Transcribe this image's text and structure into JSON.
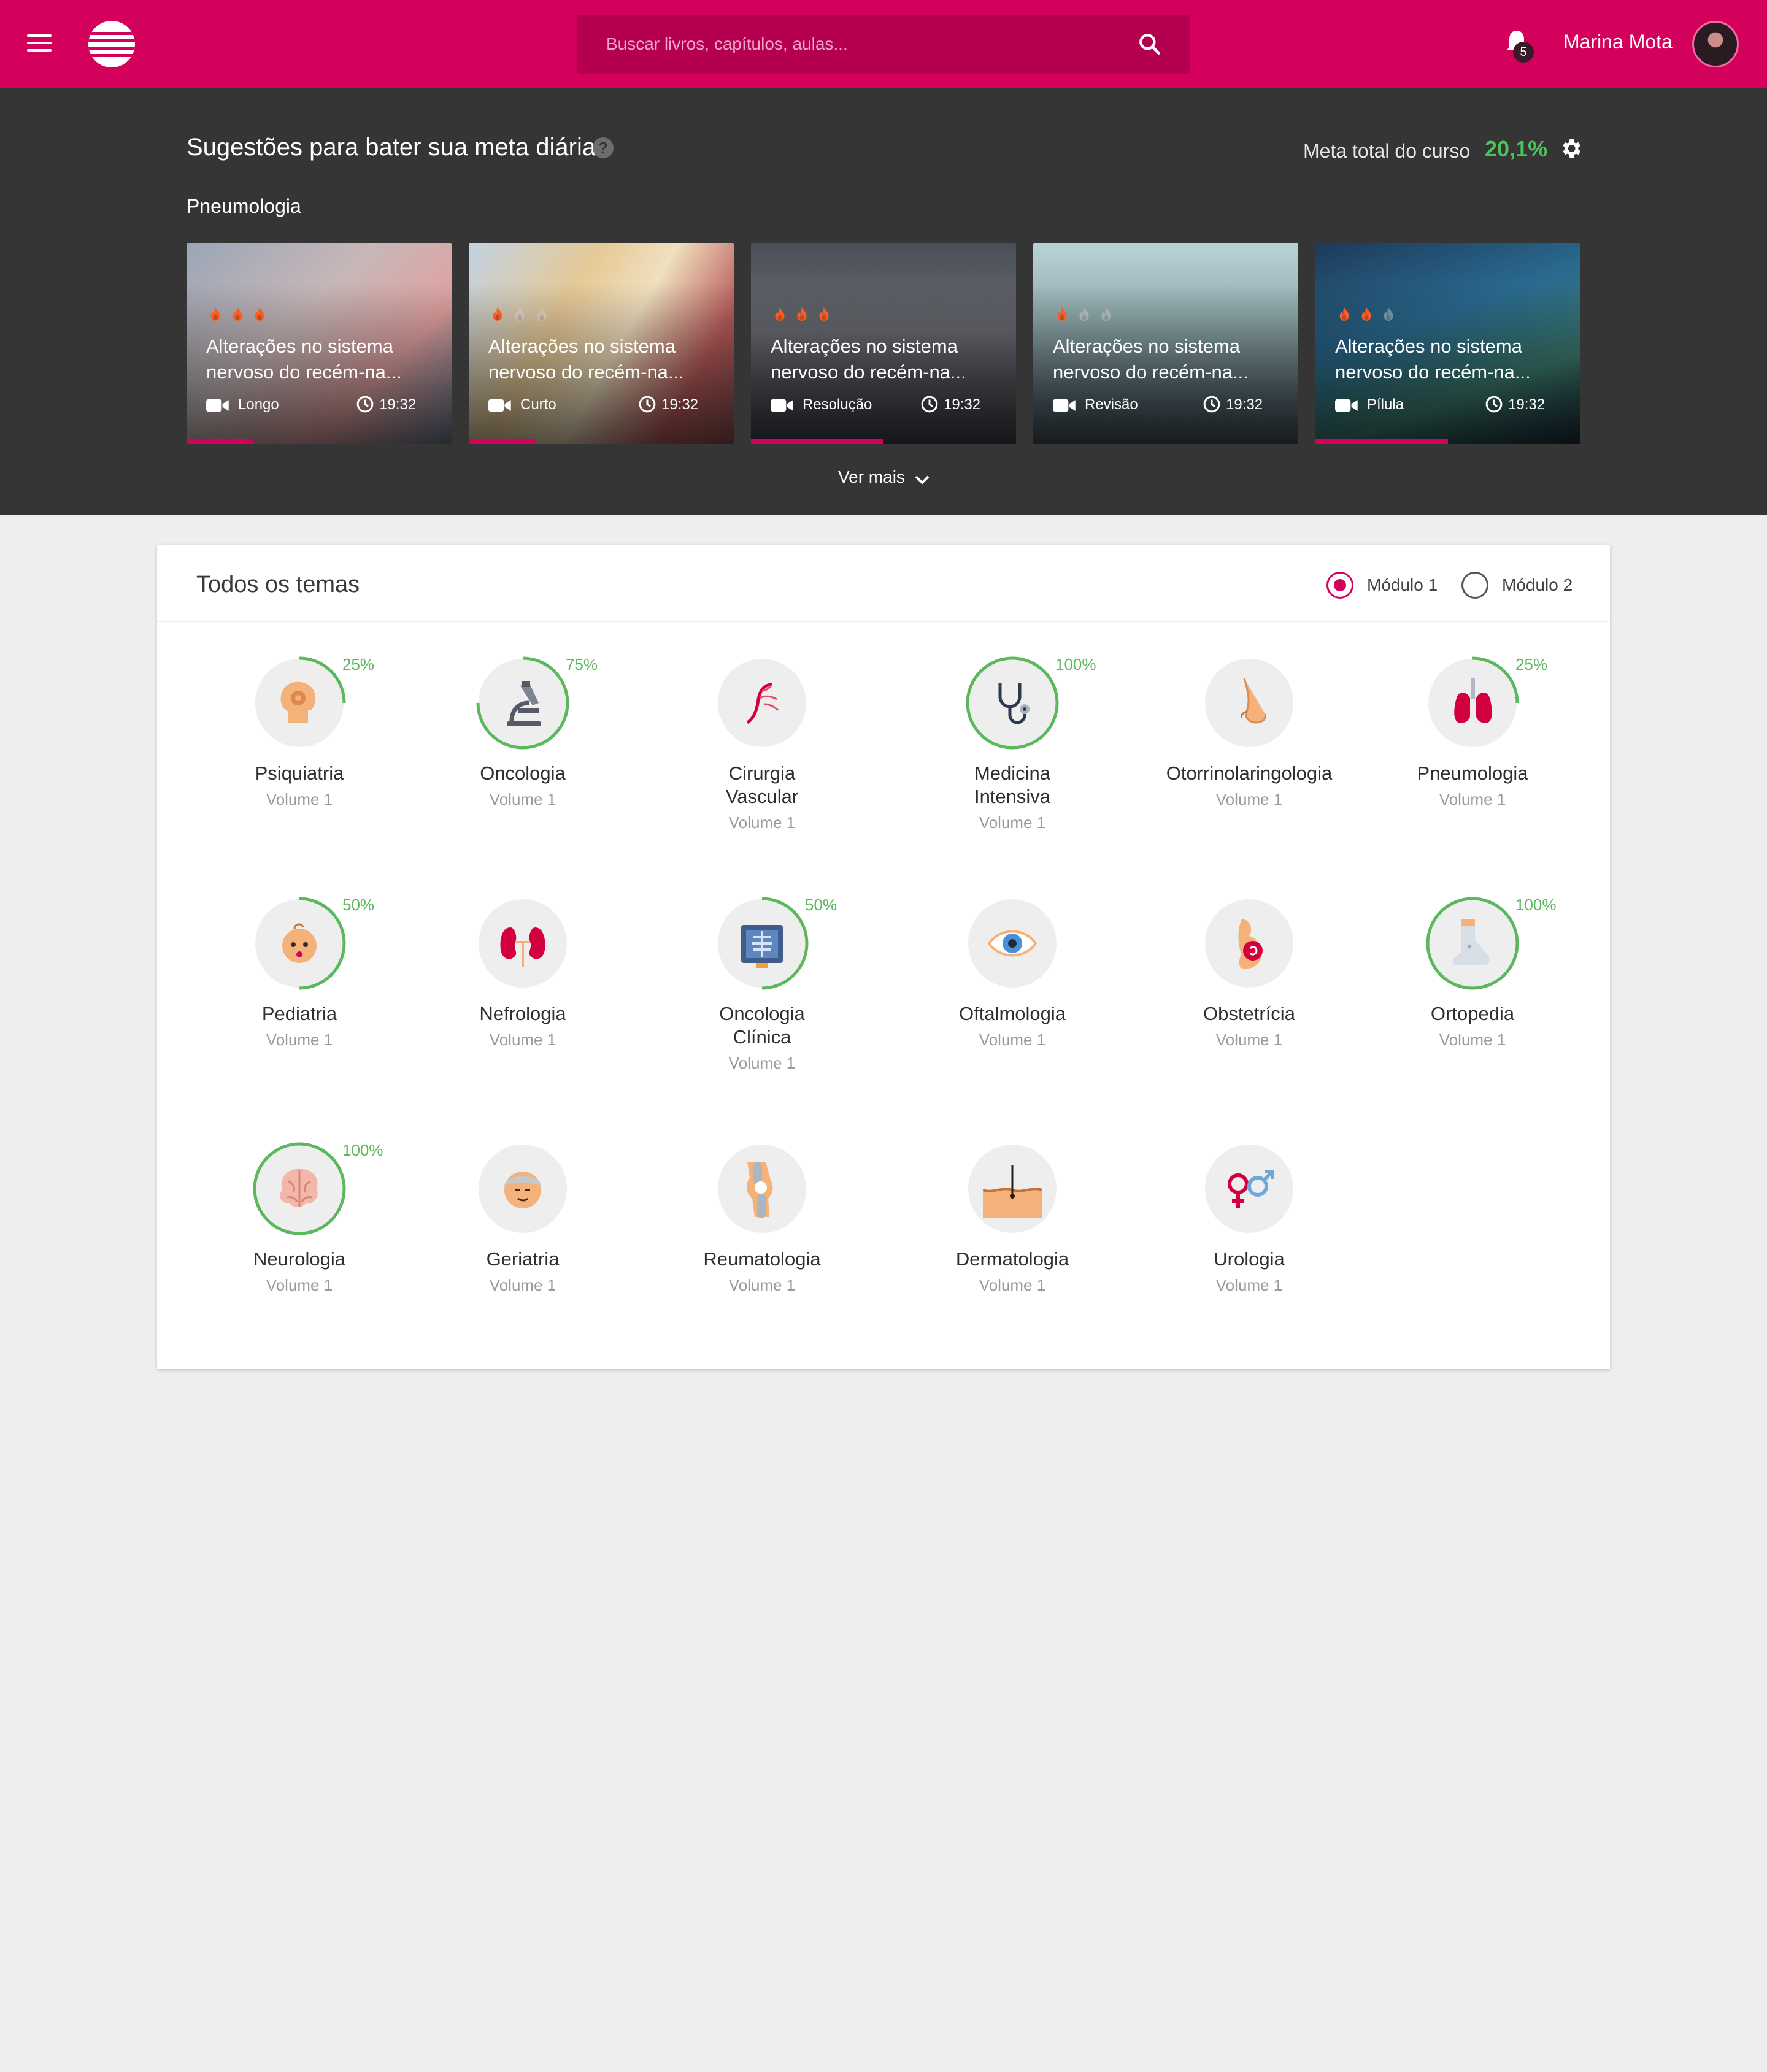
{
  "header": {
    "search_placeholder": "Buscar livros, capítulos, aulas...",
    "notification_count": "5",
    "user_name": "Marina Mota",
    "brand_color": "#d3005c"
  },
  "suggestions": {
    "title": "Sugestões para bater sua meta diária",
    "goal_label": "Meta total do curso",
    "goal_value": "20,1%",
    "section": "Pneumologia",
    "ver_mais": "Ver mais",
    "cards": [
      {
        "title": "Alterações no sistema nervoso do recém-na...",
        "type": "Longo",
        "time": "19:32",
        "flames": 3,
        "progress": 0.25
      },
      {
        "title": "Alterações no sistema nervoso do recém-na...",
        "type": "Curto",
        "time": "19:32",
        "flames": 1,
        "progress": 0.25
      },
      {
        "title": "Alterações no sistema nervoso do recém-na...",
        "type": "Resolução",
        "time": "19:32",
        "flames": 3,
        "progress": 0.5
      },
      {
        "title": "Alterações no sistema nervoso do recém-na...",
        "type": "Revisão",
        "time": "19:32",
        "flames": 1,
        "progress": 0
      },
      {
        "title": "Alterações no sistema nervoso do recém-na...",
        "type": "Pílula",
        "time": "19:32",
        "flames": 2,
        "progress": 0.5
      }
    ]
  },
  "themes": {
    "title": "Todos os temas",
    "modules": [
      {
        "label": "Módulo 1",
        "selected": true
      },
      {
        "label": "Módulo 2",
        "selected": false
      }
    ],
    "items": [
      {
        "name": "Psiquiatria",
        "volume": "Volume 1",
        "percent": "25%",
        "icon": "head-gear-icon"
      },
      {
        "name": "Oncologia",
        "volume": "Volume 1",
        "percent": "75%",
        "icon": "microscope-icon"
      },
      {
        "name": "Cirurgia Vascular",
        "volume": "Volume 1",
        "percent": "",
        "icon": "vessel-icon"
      },
      {
        "name": "Medicina Intensiva",
        "volume": "Volume 1",
        "percent": "100%",
        "icon": "stethoscope-icon"
      },
      {
        "name": "Otorrinolaringologia",
        "volume": "Volume 1",
        "percent": "",
        "icon": "nose-icon"
      },
      {
        "name": "Pneumologia",
        "volume": "Volume 1",
        "percent": "25%",
        "icon": "lungs-icon"
      },
      {
        "name": "Pediatria",
        "volume": "Volume 1",
        "percent": "50%",
        "icon": "baby-icon"
      },
      {
        "name": "Nefrologia",
        "volume": "Volume 1",
        "percent": "",
        "icon": "kidneys-icon"
      },
      {
        "name": "Oncologia Clínica",
        "volume": "Volume 1",
        "percent": "50%",
        "icon": "xray-icon"
      },
      {
        "name": "Oftalmologia",
        "volume": "Volume 1",
        "percent": "",
        "icon": "eye-icon"
      },
      {
        "name": "Obstetrícia",
        "volume": "Volume 1",
        "percent": "",
        "icon": "pregnancy-icon"
      },
      {
        "name": "Ortopedia",
        "volume": "Volume 1",
        "percent": "100%",
        "icon": "cast-leg-icon"
      },
      {
        "name": "Neurologia",
        "volume": "Volume 1",
        "percent": "100%",
        "icon": "brain-icon"
      },
      {
        "name": "Geriatria",
        "volume": "Volume 1",
        "percent": "",
        "icon": "elder-icon"
      },
      {
        "name": "Reumatologia",
        "volume": "Volume 1",
        "percent": "",
        "icon": "knee-icon"
      },
      {
        "name": "Dermatologia",
        "volume": "Volume 1",
        "percent": "",
        "icon": "skin-icon"
      },
      {
        "name": "Urologia",
        "volume": "Volume 1",
        "percent": "",
        "icon": "gender-icon"
      }
    ]
  }
}
